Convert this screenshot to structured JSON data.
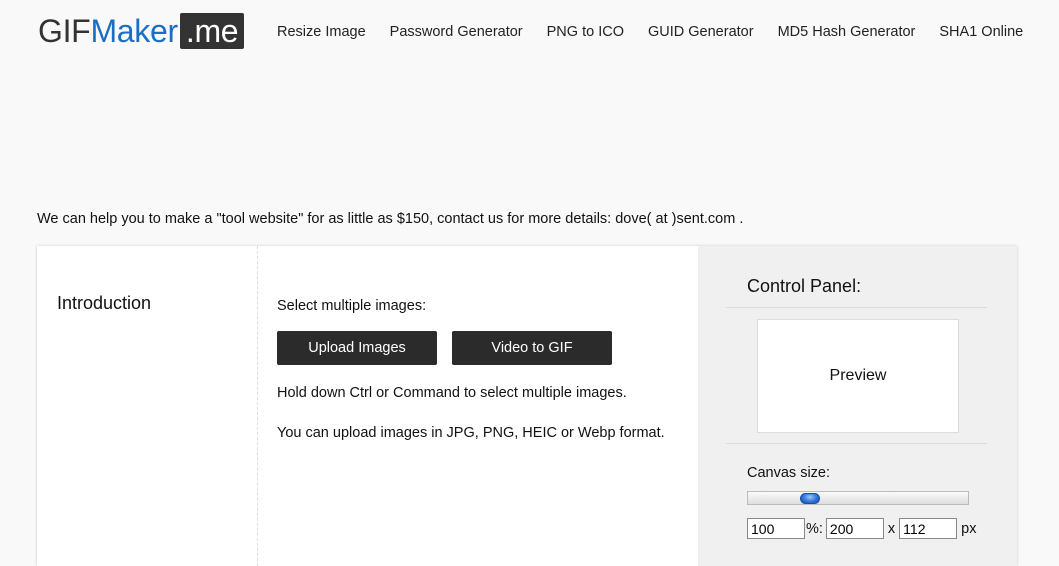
{
  "logo": {
    "part1": "GIF",
    "part2": "Maker",
    "part3": ".me"
  },
  "nav": [
    "Resize Image",
    "Password Generator",
    "PNG to ICO",
    "GUID Generator",
    "MD5 Hash Generator",
    "SHA1 Online"
  ],
  "promo": "We can help you to make a \"tool website\" for as little as $150, contact us for more details: dove( at )sent.com .",
  "intro": {
    "title": "Introduction"
  },
  "upload": {
    "label": "Select multiple images:",
    "upload_button": "Upload Images",
    "video_button": "Video to GIF",
    "hint_multiple": "Hold down Ctrl or Command to select multiple images.",
    "hint_formats": "You can upload images in JPG, PNG, HEIC or Webp format."
  },
  "control_panel": {
    "title": "Control Panel:",
    "preview_label": "Preview",
    "canvas_size_label": "Canvas size:",
    "slider_level": 0.28,
    "percent_value": "100",
    "percent_symbol": "%:",
    "width_value": "200",
    "times_symbol": "x",
    "height_value": "112",
    "unit": "px"
  },
  "colors": {
    "logo_blue": "#1a6fc4",
    "button_dark": "#2b2b2b",
    "knob_blue": "#2e74d8"
  }
}
